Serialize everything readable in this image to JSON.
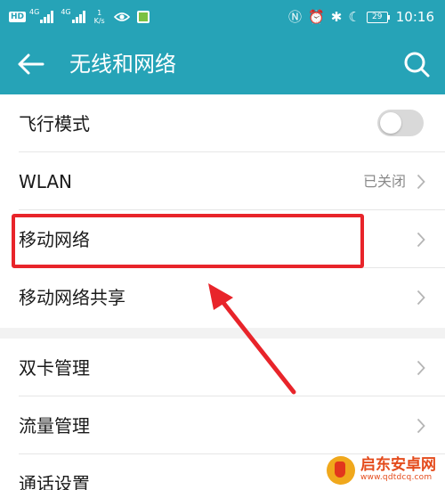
{
  "status_bar": {
    "hd_label": "HD",
    "sim1_net": "4G",
    "sim2_net": "4G",
    "speed_value": "1",
    "speed_unit": "K/s",
    "battery": "29",
    "time": "10:16"
  },
  "app_bar": {
    "title": "无线和网络"
  },
  "groups": [
    {
      "items": [
        {
          "label": "飞行模式",
          "control": "toggle",
          "on": false
        },
        {
          "label": "WLAN",
          "value": "已关闭",
          "control": "chevron"
        },
        {
          "label": "移动网络",
          "control": "chevron",
          "highlighted": true
        },
        {
          "label": "移动网络共享",
          "control": "chevron"
        }
      ]
    },
    {
      "items": [
        {
          "label": "双卡管理",
          "control": "chevron"
        },
        {
          "label": "流量管理",
          "control": "chevron"
        },
        {
          "label": "通话设置",
          "control": "chevron"
        }
      ]
    }
  ],
  "watermark": {
    "name": "启东安卓网",
    "url": "www.qdtdcq.com"
  },
  "colors": {
    "accent": "#26a3b7",
    "annotation": "#e8242a"
  }
}
